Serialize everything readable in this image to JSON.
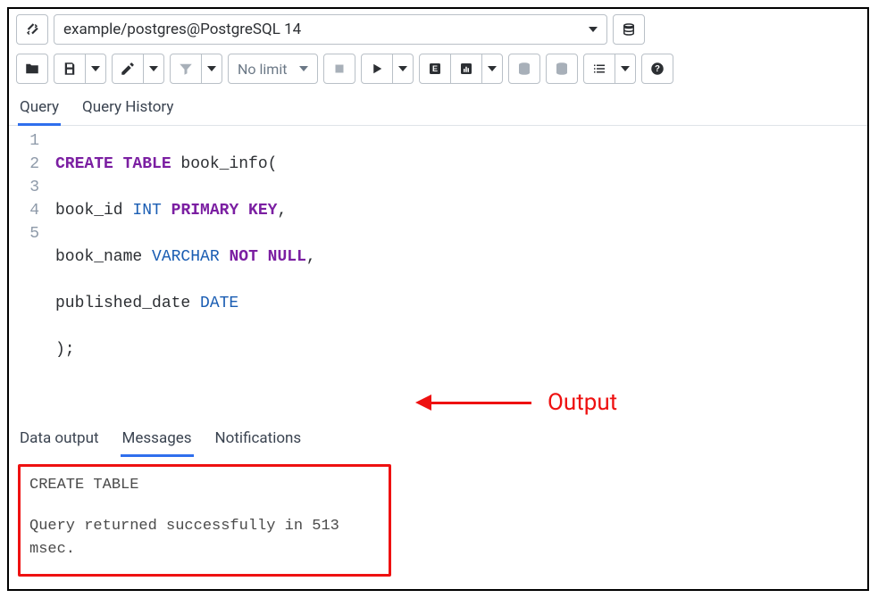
{
  "connection": {
    "label": "example/postgres@PostgreSQL 14"
  },
  "toolbar": {
    "limit_label": "No limit"
  },
  "tabs": {
    "query": "Query",
    "history": "Query History"
  },
  "code": {
    "lines": [
      "1",
      "2",
      "3",
      "4",
      "5"
    ],
    "l1_kw": "CREATE TABLE",
    "l1_rest": " book_info(",
    "l2a": "book_id ",
    "l2_type": "INT",
    "l2_sp": " ",
    "l2_kw": "PRIMARY KEY",
    "l2_end": ",",
    "l3a": "book_name ",
    "l3_type": "VARCHAR",
    "l3_sp": " ",
    "l3_kw": "NOT NULL",
    "l3_end": ",",
    "l4a": "published_date ",
    "l4_type": "DATE",
    "l5": ");"
  },
  "out_tabs": {
    "data": "Data output",
    "messages": "Messages",
    "notifications": "Notifications"
  },
  "messages": {
    "line1": "CREATE TABLE",
    "line2": "Query returned successfully in 513 msec."
  },
  "annotation": {
    "label": "Output"
  }
}
